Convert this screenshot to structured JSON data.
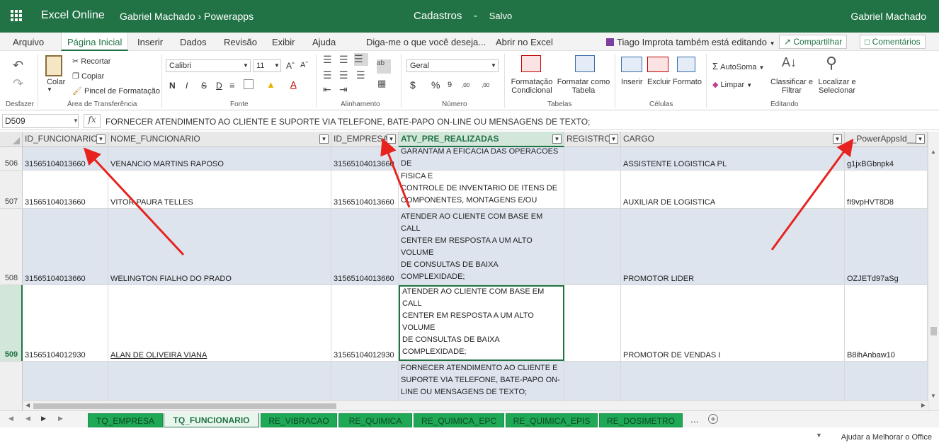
{
  "topbar": {
    "app": "Excel Online",
    "crumb": "Gabriel Machado › Powerapps",
    "doc_title": "Cadastros",
    "doc_sep": "-",
    "doc_status": "Salvo",
    "user": "Gabriel Machado"
  },
  "menu": {
    "tabs": [
      "Arquivo",
      "Página Inicial",
      "Inserir",
      "Dados",
      "Revisão",
      "Exibir",
      "Ajuda",
      "Diga-me o que você deseja...",
      "Abrir no Excel"
    ],
    "active": "Página Inicial",
    "editing": "Tiago Improta também está editando",
    "share": "Compartilhar",
    "comments": "Comentários"
  },
  "ribbon": {
    "undo_label": "Desfazer",
    "paste_label": "Colar",
    "cut": "Recortar",
    "copy": "Copiar",
    "format_painter": "Pincel de Formatação",
    "clipboard_group": "Área de Transferência",
    "font_name": "Calibri",
    "font_size": "11",
    "bold": "N",
    "italic": "I",
    "strike": "S",
    "underline": "D",
    "font_group": "Fonte",
    "align_group": "Alinhamento",
    "number_format": "Geral",
    "number_group": "Número",
    "cond_format": "Formatação Condicional",
    "format_table": "Formatar como Tabela",
    "tables_group": "Tabelas",
    "insert": "Inserir",
    "delete": "Excluir",
    "format": "Formato",
    "cells_group": "Células",
    "autosum": "AutoSoma",
    "clear": "Limpar",
    "sort_filter": "Classificar e Filtrar",
    "find_select": "Localizar e Selecionar",
    "editing_group": "Editando"
  },
  "formula_bar": {
    "name_box": "D509",
    "fx": "fx",
    "content": "FORNECER  ATENDIMENTO AO CLIENTE E SUPORTE VIA TELEFONE, BATE-PAPO ON-LINE OU MENSAGENS DE TEXTO;"
  },
  "columns": {
    "id_funcionario": "ID_FUNCIONARIO",
    "nome_funcionario": "NOME_FUNCIONARIO",
    "id_empresa": "ID_EMPRESA",
    "atv": "ATV_PRE_REALIZADAS",
    "registro": "REGISTRO",
    "cargo": "CARGO",
    "powerapps": "__PowerAppsId__"
  },
  "rows": [
    {
      "num": "506",
      "id": "31565104013660",
      "nome": "VENANCIO MARTINS RAPOSO",
      "empresa": "31565104013660",
      "atv": "GARANTAM A EFICACIA DAS OPERACOES DE\nPROGRAMACAO, RECEBIMENTO, CONTROLE",
      "cargo": "ASSISTENTE LOGISTICA PL",
      "pid": "g1jxBGbnpk4"
    },
    {
      "num": "507",
      "id": "31565104013660",
      "nome": "VITOR PAURA TELLES",
      "empresa": "31565104013660",
      "atv": "SER RESPONSAVEL PELA CUSTODIA FISICA E\nCONTROLE DE INVENTARIO DE ITENS DE\nCOMPONENTES, MONTAGENS E/OU",
      "cargo": "AUXILIAR DE LOGISTICA",
      "pid": "fI9vpHVT8D8"
    },
    {
      "num": "508",
      "id": "31565104013660",
      "nome": "WELINGTON FIALHO DO PRADO",
      "empresa": "31565104013660",
      "atv": "FORNECER  ATENDIMENTO AO CLIENTE E\nSUPORTE VIA TELEFONE, BATE-PAPO ON-\nLINE OU MENSAGENS DE TEXTO;\nATENDER AO CLIENTE COM BASE EM CALL\nCENTER EM RESPOSTA A UM ALTO VOLUME\nDE CONSULTAS DE BAIXA COMPLEXIDADE;",
      "cargo": "PROMOTOR LIDER",
      "pid": "OZJETd97aSg"
    },
    {
      "num": "509",
      "id": "31565104012930",
      "nome": "ALAN DE OLIVEIRA VIANA",
      "empresa": "31565104012930",
      "atv": "FORNECER  ATENDIMENTO AO CLIENTE E\nSUPORTE VIA TELEFONE, BATE-PAPO ON-\nLINE OU MENSAGENS DE TEXTO;\nATENDER AO CLIENTE COM BASE EM CALL\nCENTER EM RESPOSTA A UM ALTO VOLUME\nDE CONSULTAS DE BAIXA COMPLEXIDADE;",
      "cargo": "PROMOTOR DE VENDAS I",
      "pid": "B8ihAnbaw10"
    },
    {
      "num": "",
      "id": "",
      "nome": "",
      "empresa": "",
      "atv": "FORNECER  ATENDIMENTO AO CLIENTE E\nSUPORTE VIA TELEFONE, BATE-PAPO ON-\nLINE OU MENSAGENS DE TEXTO;",
      "cargo": "",
      "pid": ""
    }
  ],
  "sheets": [
    "TQ_EMPRESA",
    "TQ_FUNCIONARIO",
    "RE_VIBRACAO",
    "RE_QUIMICA",
    "RE_QUIMICA_EPC",
    "RE_QUIMICA_EPIS",
    "RE_DOSIMETRO"
  ],
  "active_sheet": "TQ_FUNCIONARIO",
  "sheet_more": "...",
  "status": {
    "help": "Ajudar a Melhorar o Office"
  },
  "colors": {
    "brand": "#217346",
    "arrow": "#e8231f",
    "band": "#dde4ee",
    "sheet_tab": "#1fa855"
  }
}
